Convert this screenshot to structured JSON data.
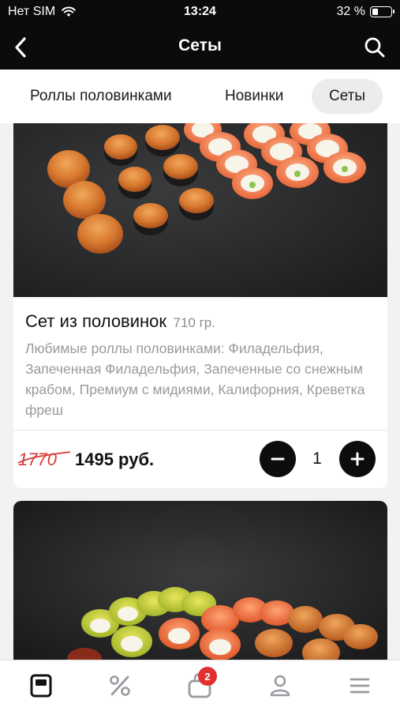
{
  "status": {
    "carrier": "Нет SIM",
    "time": "13:24",
    "battery_text": "32 %",
    "battery_level": 0.32
  },
  "nav": {
    "title": "Сеты"
  },
  "tabs": [
    {
      "label": "Роллы половинками",
      "active": false
    },
    {
      "label": "Новинки",
      "active": false
    },
    {
      "label": "Сеты",
      "active": true
    }
  ],
  "product": {
    "title": "Сет из половинок",
    "weight": "710 гр.",
    "description": "Любимые роллы половинками: Филадельфия, Запеченная Филадельфия, Запеченные со снежным крабом, Премиум с мидиями, Калифорния, Креветка фреш",
    "old_price": "1770",
    "new_price": "1495 руб.",
    "quantity": "1"
  },
  "bottom_nav": {
    "items": [
      "menu-icon",
      "percent-icon",
      "cart-icon",
      "profile-icon",
      "hamburger-icon"
    ],
    "cart_badge": "2",
    "active_color": "#111111",
    "inactive_color": "#9a9aa0"
  },
  "colors": {
    "header_bg": "#0b0b0b",
    "old_price": "#d63a36",
    "badge": "#e03030"
  }
}
